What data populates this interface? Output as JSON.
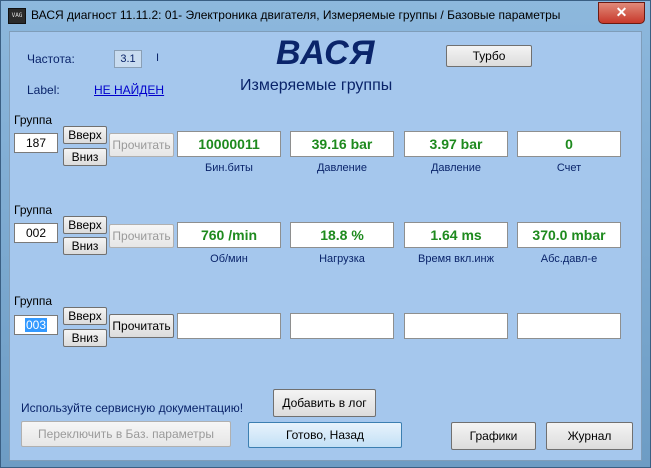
{
  "window": {
    "title": "ВАСЯ диагност 11.11.2: 01- Электроника двигателя,  Измеряемые группы / Базовые параметры",
    "icon_text": "VAG",
    "close_symbol": "✕"
  },
  "header": {
    "freq_label": "Частота:",
    "freq_value": "3.1",
    "freq_sep": "I",
    "label_label": "Label:",
    "label_value": "НЕ НАЙДЕН",
    "logo": "ВАСЯ",
    "subtitle": "Измеряемые группы",
    "turbo_button": "Турбо"
  },
  "groups": [
    {
      "label": "Группа",
      "number": "187",
      "up": "Вверх",
      "down": "Вниз",
      "read": "Прочитать",
      "values": [
        "10000011",
        "39.16 bar",
        "3.97 bar",
        "0"
      ],
      "captions": [
        "Бин.биты",
        "Давление",
        "Давление",
        "Счет"
      ]
    },
    {
      "label": "Группа",
      "number": "002",
      "up": "Вверх",
      "down": "Вниз",
      "read": "Прочитать",
      "values": [
        "760 /min",
        "18.8 %",
        "1.64 ms",
        "370.0 mbar"
      ],
      "captions": [
        "Об/мин",
        "Нагрузка",
        "Время вкл.инж",
        "Абс.давл-е"
      ]
    },
    {
      "label": "Группа",
      "number": "003",
      "up": "Вверх",
      "down": "Вниз",
      "read": "Прочитать",
      "values": [
        "",
        "",
        "",
        ""
      ],
      "captions": [
        "",
        "",
        "",
        ""
      ]
    }
  ],
  "footer": {
    "notice": "Используйте сервисную документацию!",
    "add_log": "Добавить в лог",
    "switch_basic": "Переключить в Баз. параметры",
    "done_back": "Готово, Назад",
    "graphs": "Графики",
    "journal": "Журнал"
  },
  "colors": {
    "value_text": "#1e8a1e",
    "label_text": "#0a246a",
    "client_bg": "#a5c7ed",
    "logo": "#0a246a"
  }
}
